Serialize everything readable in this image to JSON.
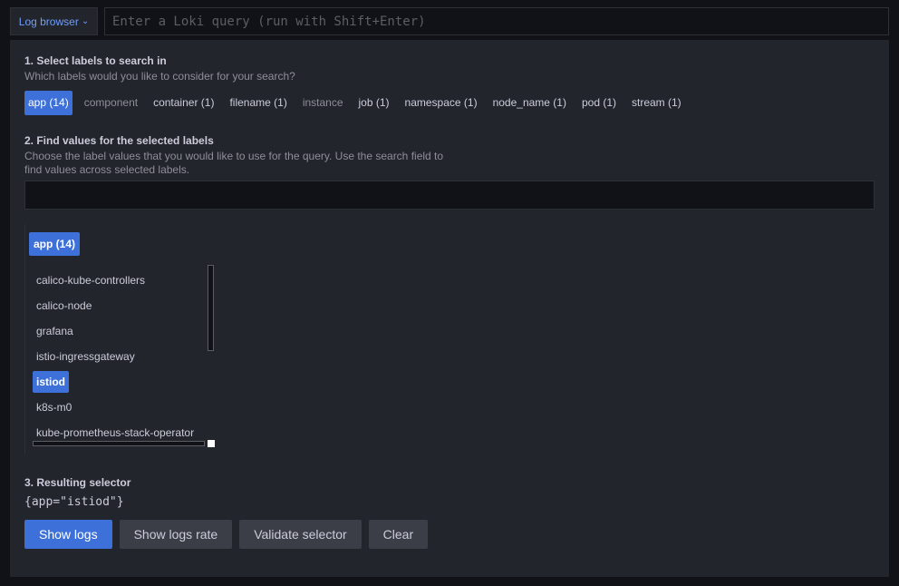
{
  "topbar": {
    "log_browser_label": "Log browser",
    "query_placeholder": "Enter a Loki query (run with Shift+Enter)"
  },
  "step1": {
    "title": "1. Select labels to search in",
    "description": "Which labels would you like to consider for your search?",
    "labels": [
      {
        "label": "app (14)",
        "state": "selected"
      },
      {
        "label": "component",
        "state": "dim"
      },
      {
        "label": "container (1)",
        "state": "normal"
      },
      {
        "label": "filename (1)",
        "state": "normal"
      },
      {
        "label": "instance",
        "state": "dim"
      },
      {
        "label": "job (1)",
        "state": "normal"
      },
      {
        "label": "namespace (1)",
        "state": "normal"
      },
      {
        "label": "node_name (1)",
        "state": "normal"
      },
      {
        "label": "pod (1)",
        "state": "normal"
      },
      {
        "label": "stream (1)",
        "state": "normal"
      }
    ]
  },
  "step2": {
    "title": "2. Find values for the selected labels",
    "description_line1": "Choose the label values that you would like to use for the query. Use the search field to",
    "description_line2": "find values across selected labels.",
    "search_value": "",
    "values_header": "app (14)",
    "values": [
      {
        "label": "calico-kube-controllers",
        "selected": false
      },
      {
        "label": "calico-node",
        "selected": false
      },
      {
        "label": "grafana",
        "selected": false
      },
      {
        "label": "istio-ingressgateway",
        "selected": false
      },
      {
        "label": "istiod",
        "selected": true
      },
      {
        "label": "k8s-m0",
        "selected": false
      },
      {
        "label": "kube-prometheus-stack-operator",
        "selected": false
      }
    ]
  },
  "step3": {
    "title": "3. Resulting selector",
    "selector": "{app=\"istiod\"}"
  },
  "buttons": {
    "show_logs": "Show logs",
    "show_logs_rate": "Show logs rate",
    "validate_selector": "Validate selector",
    "clear": "Clear"
  },
  "colors": {
    "accent": "#3d71d9",
    "background": "#111217",
    "panel": "#22252b"
  }
}
